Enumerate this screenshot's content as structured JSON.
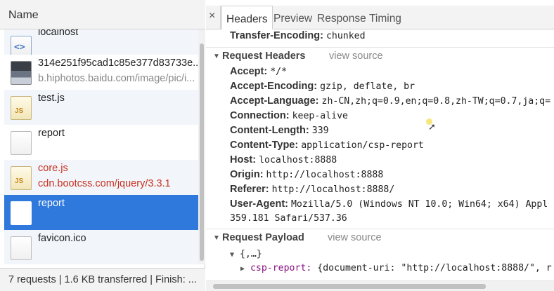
{
  "list": {
    "header": "Name",
    "rows": [
      {
        "name": "localhost",
        "sub": "",
        "icon": "html-file-icon",
        "style": "alt"
      },
      {
        "name": "314e251f95cad1c85e377d83733e...",
        "sub": "b.hiphotos.baidu.com/image/pic/i...",
        "icon": "image-file-icon",
        "style": "plain"
      },
      {
        "name": "test.js",
        "sub": "",
        "icon": "js-file-icon",
        "style": "alt"
      },
      {
        "name": "report",
        "sub": "",
        "icon": "blank-file-icon",
        "style": "plain"
      },
      {
        "name": "core.js",
        "sub": "cdn.bootcss.com/jquery/3.3.1",
        "icon": "js-file-icon",
        "style": "alt-red"
      },
      {
        "name": "report",
        "sub": "",
        "icon": "blank-file-icon",
        "style": "selected"
      },
      {
        "name": "favicon.ico",
        "sub": "",
        "icon": "blank-file-icon",
        "style": "alt"
      }
    ],
    "status": "7 requests  |  1.6 KB transferred  |  Finish: ..."
  },
  "tabs": {
    "close": "×",
    "items": [
      "Headers",
      "Preview",
      "Response",
      "Timing"
    ],
    "active": "Headers"
  },
  "headers": {
    "top": {
      "key": "Transfer-Encoding:",
      "value": "chunked"
    },
    "request_title": "Request Headers",
    "view_source": "view source",
    "request": [
      {
        "key": "Accept:",
        "value": "*/*"
      },
      {
        "key": "Accept-Encoding:",
        "value": "gzip, deflate, br"
      },
      {
        "key": "Accept-Language:",
        "value": "zh-CN,zh;q=0.9,en;q=0.8,zh-TW;q=0.7,ja;q="
      },
      {
        "key": "Connection:",
        "value": "keep-alive"
      },
      {
        "key": "Content-Length:",
        "value": "339"
      },
      {
        "key": "Content-Type:",
        "value": "application/csp-report"
      },
      {
        "key": "Host:",
        "value": "localhost:8888"
      },
      {
        "key": "Origin:",
        "value": "http://localhost:8888"
      },
      {
        "key": "Referer:",
        "value": "http://localhost:8888/"
      },
      {
        "key": "User-Agent:",
        "value": "Mozilla/5.0 (Windows NT 10.0; Win64; x64) Appl"
      }
    ],
    "ua_continuation": "359.181 Safari/537.36",
    "payload_title": "Request Payload",
    "payload_view_source": "view source",
    "payload_root": "{,…}",
    "payload_key": "csp-report:",
    "payload_value": "{document-uri: \"http://localhost:8888/\", r"
  }
}
